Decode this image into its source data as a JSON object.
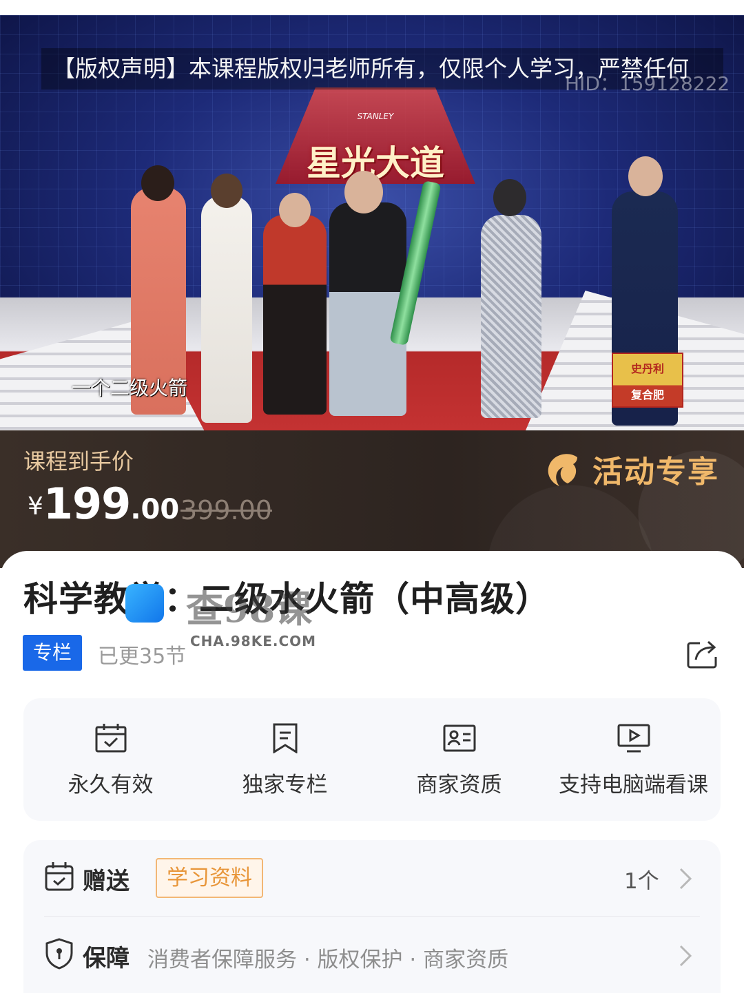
{
  "video": {
    "copyright_text": "【版权声明】本课程版权归老师所有，仅限个人学习，严禁任何",
    "uid": "HID：159128222",
    "show_brand": "STANLEY",
    "show_title": "星光大道",
    "caption": "一个二级火箭",
    "sponsor_top": "史丹利",
    "sponsor_bottom": "复合肥"
  },
  "price": {
    "label": "课程到手价",
    "currency": "¥",
    "integer": "199",
    "decimal": ".00",
    "original": "399.00",
    "promo": "活动专享"
  },
  "course": {
    "title": "科学教学：二级水火箭（中高级）",
    "tag": "专栏",
    "updated": "已更35节"
  },
  "watermark": {
    "big": "查98课",
    "small": "CHA.98KE.COM"
  },
  "features": [
    {
      "icon": "calendar-check-icon",
      "label": "永久有效"
    },
    {
      "icon": "document-icon",
      "label": "独家专栏"
    },
    {
      "icon": "id-card-icon",
      "label": "商家资质"
    },
    {
      "icon": "monitor-play-icon",
      "label": "支持电脑端看课"
    }
  ],
  "services": {
    "gift_title": "赠送",
    "gift_chip": "学习资料",
    "gift_count": "1个",
    "guarantee_title": "保障",
    "guarantee_text": "消费者保障服务 · 版权保护 · 商家资质"
  },
  "colors": {
    "accent_blue": "#1968e8",
    "promo_gold": "#f0b86a",
    "chip_orange": "#e8963a"
  }
}
